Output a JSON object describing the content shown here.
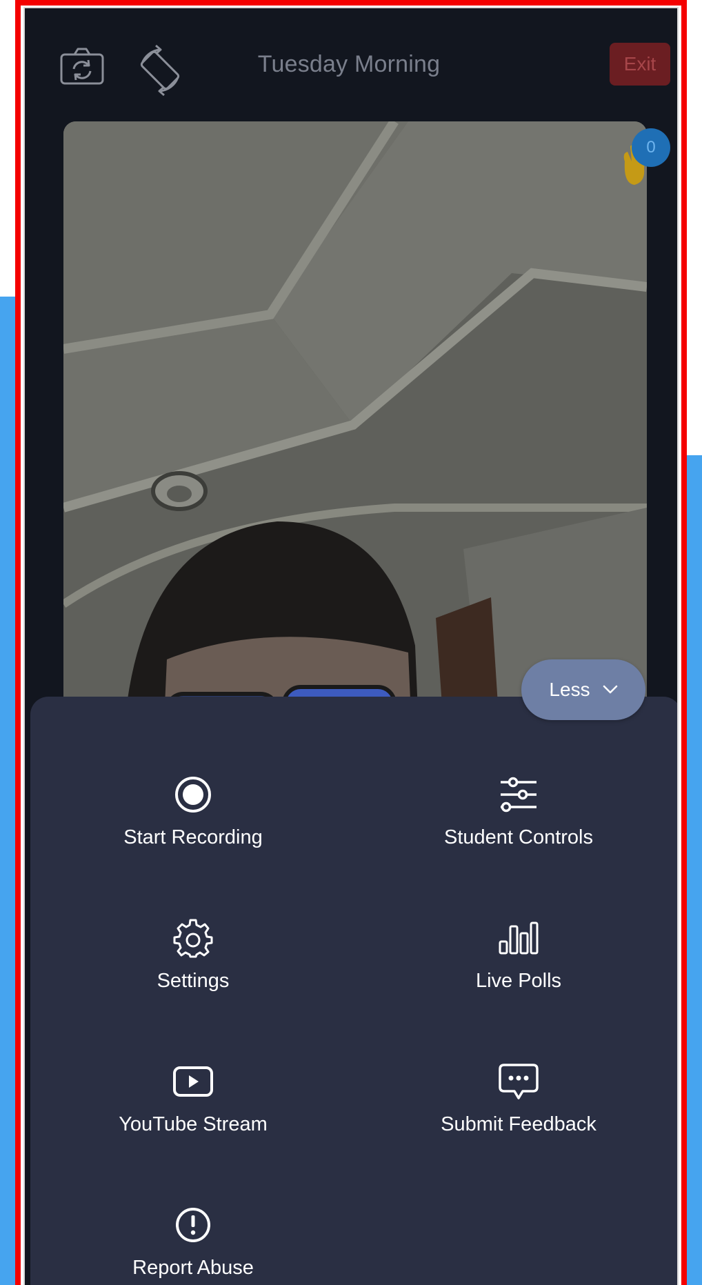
{
  "header": {
    "title": "Tuesday Morning",
    "exit_label": "Exit",
    "camera_switch_icon": "camera-switch-icon",
    "rotate_icon": "screen-rotate-icon"
  },
  "video": {
    "raised_hands_count": "0"
  },
  "toggle": {
    "label": "Less",
    "icon": "chevron-down-icon"
  },
  "menu": {
    "items": [
      {
        "label": "Start Recording",
        "icon": "record-icon"
      },
      {
        "label": "Student Controls",
        "icon": "sliders-icon"
      },
      {
        "label": "Settings",
        "icon": "gear-icon"
      },
      {
        "label": "Live Polls",
        "icon": "bar-chart-icon"
      },
      {
        "label": "YouTube Stream",
        "icon": "play-icon"
      },
      {
        "label": "Submit Feedback",
        "icon": "chat-bubble-icon"
      },
      {
        "label": "Report Abuse",
        "icon": "alert-icon"
      }
    ]
  },
  "colors": {
    "screen_bg": "#12161f",
    "sheet_bg": "#2a2f43",
    "exit_bg": "#6b1e22",
    "toggle_bg": "#6e7fa5",
    "badge_bg": "#1f6fb5",
    "frame": "#f40000",
    "page_accent": "#46a4ef"
  }
}
